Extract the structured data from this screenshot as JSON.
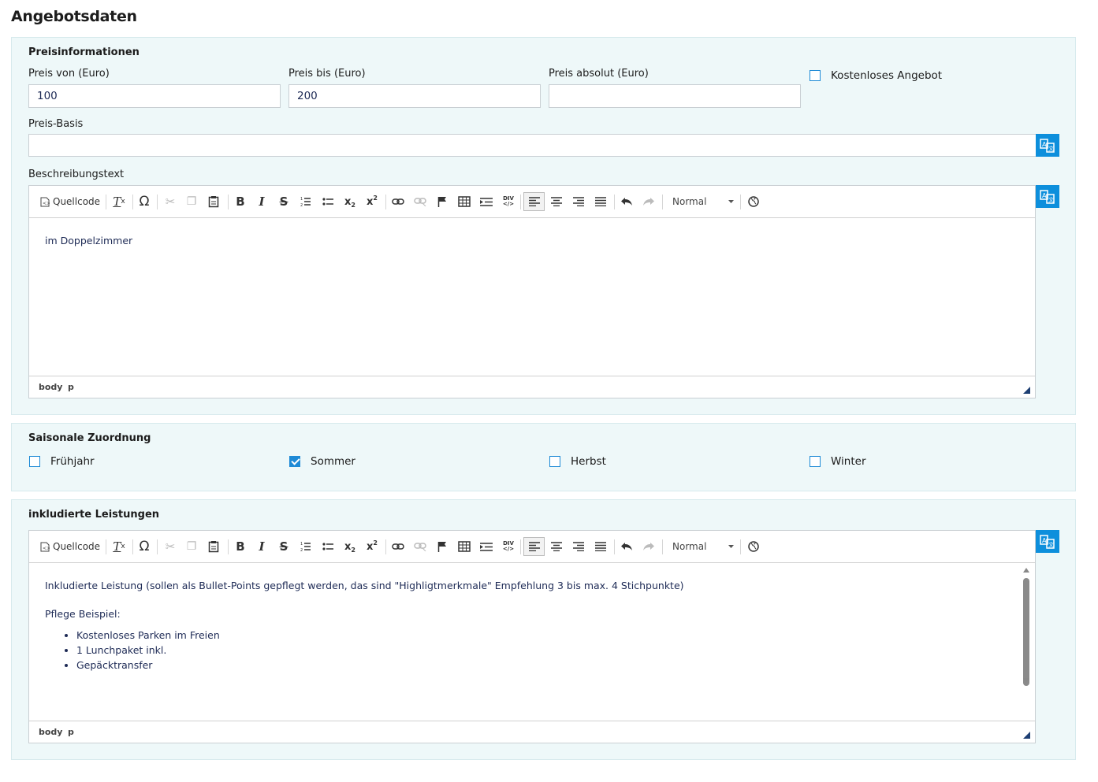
{
  "page": {
    "title": "Angebotsdaten"
  },
  "preis": {
    "section_title": "Preisinformationen",
    "von": {
      "label": "Preis von (Euro)",
      "value": "100"
    },
    "bis": {
      "label": "Preis bis (Euro)",
      "value": "200"
    },
    "absolut": {
      "label": "Preis absolut (Euro)",
      "value": ""
    },
    "kostenlos": {
      "label": "Kostenloses Angebot",
      "checked": false
    },
    "basis": {
      "label": "Preis-Basis",
      "value": ""
    },
    "beschreibung": {
      "label": "Beschreibungstext"
    }
  },
  "toolbar": {
    "source_label": "Quellcode",
    "format_label": "Normal"
  },
  "editor1": {
    "content": "im Doppelzimmer",
    "status": [
      "body",
      "p"
    ]
  },
  "saison": {
    "section_title": "Saisonale Zuordnung",
    "items": [
      {
        "label": "Frühjahr",
        "checked": false
      },
      {
        "label": "Sommer",
        "checked": true
      },
      {
        "label": "Herbst",
        "checked": false
      },
      {
        "label": "Winter",
        "checked": false
      }
    ]
  },
  "leistungen": {
    "section_title": "inkludierte Leistungen",
    "paragraph1": "Inkludierte Leistung (sollen als Bullet-Points gepflegt werden, das sind \"Highligtmerkmale\" Empfehlung 3 bis max. 4 Stichpunkte)",
    "paragraph2": "Pflege Beispiel:",
    "bullets": [
      "Kostenloses Parken im Freien",
      "1 Lunchpaket inkl.",
      "Gepäcktransfer"
    ],
    "status": [
      "body",
      "p"
    ]
  },
  "colors": {
    "accent": "#0d8fdc",
    "panel_bg": "#eef8f9",
    "text_blue": "#1d2a55"
  }
}
